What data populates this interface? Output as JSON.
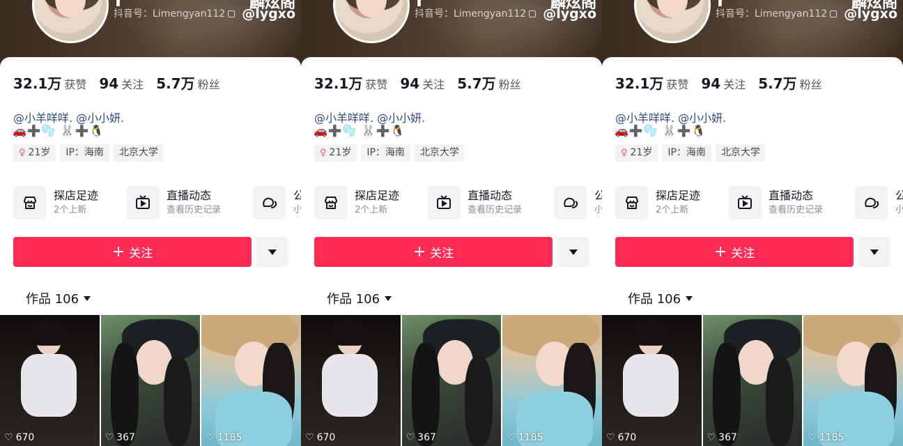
{
  "profile": {
    "name_fragment": "r",
    "douyin_id": "抖音号：Limengyan112",
    "side_title": "麟炫阁",
    "side_handle": "@lygxo"
  },
  "stats": [
    {
      "value": "32.1万",
      "label": "获赞"
    },
    {
      "value": "94",
      "label": "关注"
    },
    {
      "value": "5.7万",
      "label": "粉丝"
    }
  ],
  "bio": {
    "mentions": "@小羊咩咩. @小小妍.",
    "emoji_line": "🚗➕🫧 🐰➕🐧"
  },
  "tags": [
    {
      "icon": "female-icon",
      "label": "21岁"
    },
    {
      "label": "IP：海南"
    },
    {
      "label": "北京大学"
    }
  ],
  "features": [
    {
      "icon": "store-icon",
      "title": "探店足迹",
      "sub": "2个上新"
    },
    {
      "icon": "live-tv-icon",
      "title": "直播动态",
      "sub": "查看历史记录"
    },
    {
      "icon": "chat-bubble-icon",
      "title": "公",
      "sub": "小"
    }
  ],
  "actions": {
    "follow_label": "关注"
  },
  "works": {
    "tab_label": "作品 106"
  },
  "videos": [
    {
      "likes": "670"
    },
    {
      "likes": "367"
    },
    {
      "likes": "1185"
    }
  ],
  "colors": {
    "accent": "#fe2c55",
    "mention": "#2b4a7a",
    "header": "#3a2b1f"
  }
}
